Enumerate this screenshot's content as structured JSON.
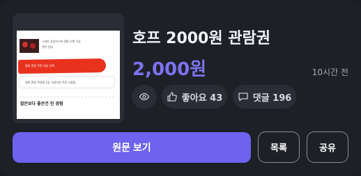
{
  "post": {
    "title": "호프 2000원 관람권",
    "price": "2,000원",
    "time_ago": "10시간 전"
  },
  "stats": {
    "likes_label": "좋아요 43",
    "comments_label": "댓글 196"
  },
  "actions": {
    "view_original": "원문 보기",
    "list": "목록",
    "share": "공유"
  },
  "thumbnail": {
    "line1": "<파란 승용차>에 관람 티켓 가능",
    "line2": "쿠폰 안내",
    "line3": "멤버 관람 쿠폰 대상 선택",
    "line4": "영화 관람 쿠폰을 1장 사용하여 쿠폰 사용함",
    "footer": "잡은보다 좋은건 인 경험"
  },
  "colors": {
    "accent": "#6d63ee",
    "price": "#7b73f0",
    "background": "#1e2027",
    "highlight_red": "#e8321e"
  }
}
